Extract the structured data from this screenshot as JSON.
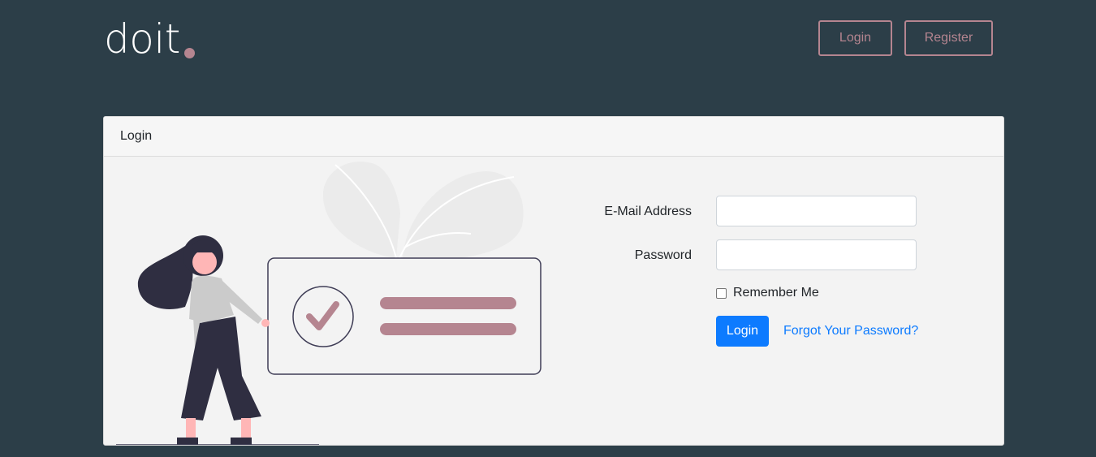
{
  "brand": {
    "name": "doit",
    "dot_color": "#b58590"
  },
  "nav": {
    "login_label": "Login",
    "register_label": "Register",
    "button_color": "#b58590"
  },
  "card": {
    "header": "Login",
    "email_label": "E-Mail Address",
    "email_value": "",
    "password_label": "Password",
    "password_value": "",
    "remember_label": "Remember Me",
    "remember_checked": false,
    "submit_label": "Login",
    "forgot_label": "Forgot Your Password?"
  },
  "colors": {
    "background": "#2c3e48",
    "primary": "#0d7bff",
    "accent": "#b58590",
    "illustration_dark": "#2f2e41"
  }
}
